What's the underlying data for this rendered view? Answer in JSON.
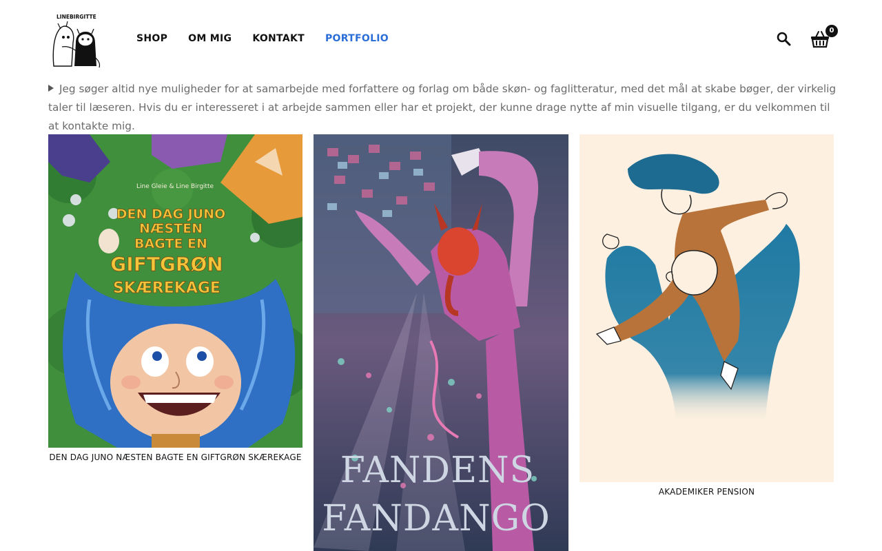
{
  "brand": {
    "logo_text": "LINEBIRGITTE"
  },
  "nav": {
    "items": [
      {
        "label": "SHOP",
        "active": false
      },
      {
        "label": "OM MIG",
        "active": false
      },
      {
        "label": "KONTAKT",
        "active": false
      },
      {
        "label": "PORTFOLIO",
        "active": true
      }
    ],
    "active_color": "#2b6ed8"
  },
  "header_icons": {
    "search": "search-icon",
    "cart": "basket-icon",
    "cart_count": "0"
  },
  "intro": {
    "text": "Jeg søger altid nye muligheder for at samarbejde med forfattere og forlag om både skøn- og faglitteratur, med det mål at skabe bøger, der virkelig taler til læseren. Hvis du er interesseret i at arbejde sammen eller har et projekt, der kunne drage nytte af min visuelle tilgang, er du velkommen til at kontakte mig."
  },
  "gallery": [
    {
      "caption": "DEN DAG JUNO NÆSTEN BAGTE EN GIFTGRØN SKÆREKAGE",
      "cover_authors": "Line Gleie & Line Birgitte",
      "cover_title_lines": [
        "DEN DAG JUNO",
        "NÆSTEN",
        "BAGTE EN",
        "GIFTGRØN",
        "SKÆREKAGE"
      ]
    },
    {
      "caption": "",
      "cover_title_lines": [
        "FANDENS",
        "FANDANGO"
      ]
    },
    {
      "caption": "AKADEMIKER PENSION"
    }
  ]
}
